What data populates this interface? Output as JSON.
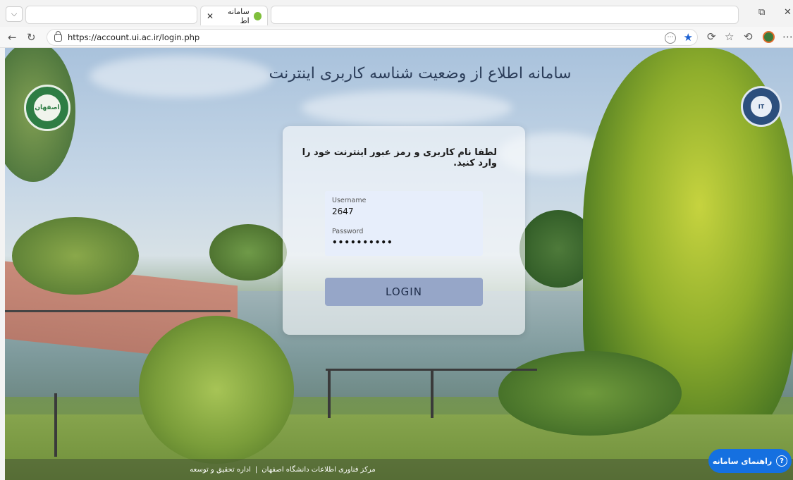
{
  "browser": {
    "tab_title": "سامانه اط",
    "url": "https://account.ui.ac.ir/login.php"
  },
  "page": {
    "title": "سامانه اطلاع از وضعیت شناسه کاربری اینترنت",
    "logo_left_text": "اصفهان",
    "logo_right_text": "IT"
  },
  "login": {
    "instruction": "لطفا نام کاربری و رمز عبور اینترنت خود را وارد کنید.",
    "username_label": "Username",
    "username_value": "2647",
    "password_label": "Password",
    "password_value": "••••••••••",
    "button_label": "LOGIN"
  },
  "footer": {
    "org": "مرکز فناوری اطلاعات دانشگاه اصفهان",
    "separator": "|",
    "dept": "اداره تحقیق و توسعه"
  },
  "help": {
    "label": "راهنمای سامانه",
    "icon": "?",
    "color": "#1570e0"
  }
}
